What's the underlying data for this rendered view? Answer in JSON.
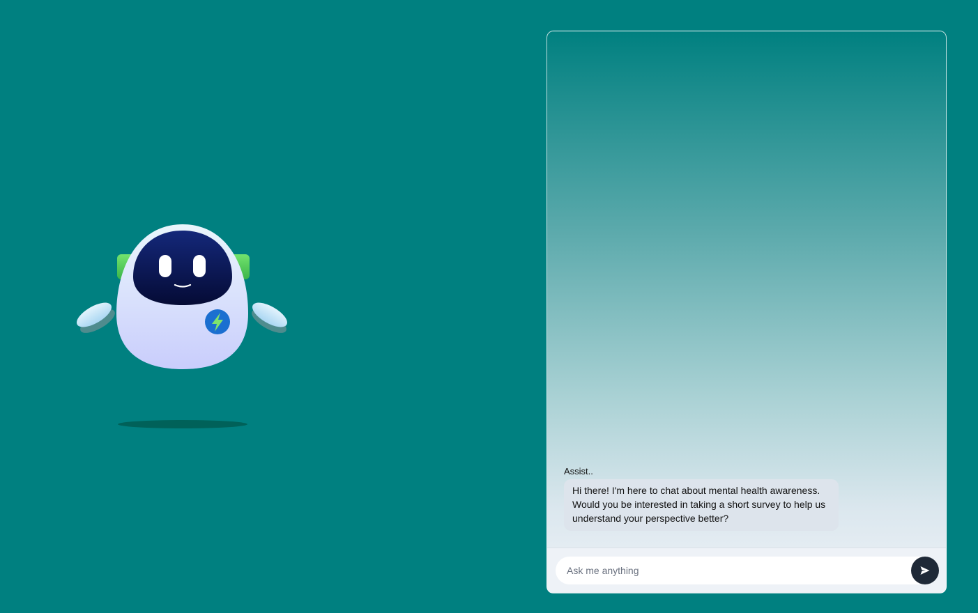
{
  "mascot": {
    "icon": "robot-mascot",
    "badge_icon": "lightning-bolt-icon"
  },
  "chat": {
    "messages": [
      {
        "sender": "Assist..",
        "text": "Hi there! I'm here to chat about mental health awareness. Would you be interested in taking a short survey to help us understand your perspective better?"
      }
    ],
    "input": {
      "placeholder": "Ask me anything",
      "value": ""
    },
    "send_icon": "send-icon"
  },
  "colors": {
    "background": "#008080",
    "bubble": "#dde4ec",
    "send_button": "#1f2937",
    "accent_green": "#5ed35e"
  }
}
